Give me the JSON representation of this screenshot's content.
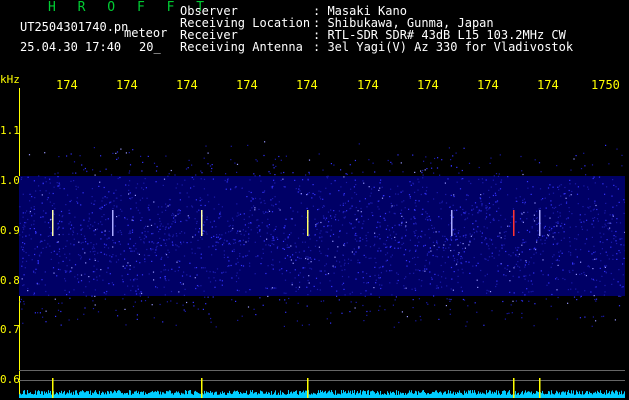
{
  "header": {
    "title": "H R O F F T",
    "filename": "UT2504301740.pn",
    "program": "meteor",
    "datetime": "25.04.30 17:40",
    "interval": "20_"
  },
  "info": {
    "labels": [
      "Observer",
      "Receiving Location",
      "Receiver",
      "Receiving Antenna"
    ],
    "values": [
      ": Masaki Kano",
      ": Shibukawa, Gunma, Japan",
      ": RTL-SDR SDR# 43dB L15 103.2MHz CW",
      ": 3el Yagi(V) Az 330 for Vladivostok"
    ]
  },
  "axes": {
    "y_unit": "kHz",
    "y_ticks": [
      "1.1",
      "1.0",
      "0.9",
      "0.8",
      "0.7",
      "0.6"
    ],
    "x_ticks": [
      "174",
      "174",
      "174",
      "174",
      "174",
      "174",
      "174",
      "174",
      "174",
      "1750"
    ]
  },
  "colors": {
    "noise_dark": "#000066",
    "noise_bright": "#3333ff",
    "meteor_echo": "#ff3333",
    "labels": "#ffff00",
    "spectrum": "#00ccff",
    "title_green": "#00cc33"
  }
}
